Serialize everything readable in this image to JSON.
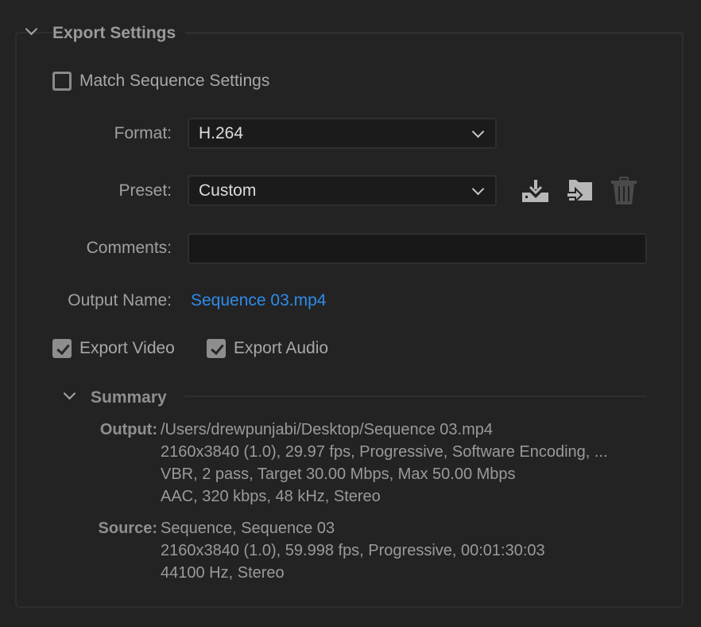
{
  "export_settings": {
    "title": "Export Settings",
    "match_sequence": {
      "label": "Match Sequence Settings",
      "checked": false
    },
    "format": {
      "label": "Format:",
      "value": "H.264"
    },
    "preset": {
      "label": "Preset:",
      "value": "Custom",
      "actions": [
        {
          "name": "save-preset",
          "icon": "save-preset-icon"
        },
        {
          "name": "import-preset",
          "icon": "import-folder-icon"
        },
        {
          "name": "delete-preset",
          "icon": "trash-icon",
          "enabled": false
        }
      ]
    },
    "comments": {
      "label": "Comments:",
      "value": ""
    },
    "output_name": {
      "label": "Output Name:",
      "value": "Sequence 03.mp4"
    },
    "export_video": {
      "label": "Export Video",
      "checked": true
    },
    "export_audio": {
      "label": "Export Audio",
      "checked": true
    }
  },
  "summary": {
    "title": "Summary",
    "output": {
      "label": "Output:",
      "lines": [
        "/Users/drewpunjabi/Desktop/Sequence 03.mp4",
        "2160x3840 (1.0), 29.97 fps, Progressive, Software Encoding, ...",
        "VBR, 2 pass, Target 30.00 Mbps, Max 50.00 Mbps",
        "AAC, 320 kbps, 48 kHz, Stereo"
      ]
    },
    "source": {
      "label": "Source:",
      "lines": [
        "Sequence, Sequence 03",
        "2160x3840 (1.0), 59.998 fps, Progressive, 00:01:30:03",
        "44100 Hz, Stereo"
      ]
    }
  },
  "colors": {
    "background": "#232323",
    "link": "#2d8ceb",
    "text": "#a8a8a8"
  }
}
